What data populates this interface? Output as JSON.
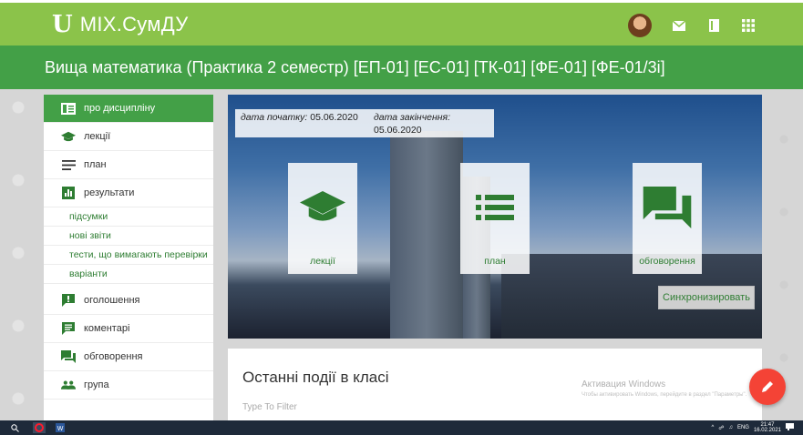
{
  "app": {
    "logo_mark": "U",
    "name": "МІХ.СумДУ"
  },
  "header_icons": [
    "avatar",
    "mail-icon",
    "book-icon",
    "apps-grid-icon"
  ],
  "course": {
    "title": "Вища математика (Практика 2 семестр) [ЕП-01] [ЕС-01] [ТК-01] [ФЕ-01] [ФЕ-01/3і]"
  },
  "sidebar": {
    "items": [
      {
        "label": "про дисципліну",
        "icon": "info-card-icon",
        "active": true
      },
      {
        "label": "лекції",
        "icon": "graduation-cap-icon"
      },
      {
        "label": "план",
        "icon": "list-icon"
      },
      {
        "label": "результати",
        "icon": "bar-chart-icon"
      }
    ],
    "sub_items": [
      "підсумки",
      "нові звіти",
      "тести, що вимагають перевірки",
      "варіанти"
    ],
    "items2": [
      {
        "label": "оголошення",
        "icon": "announcement-icon"
      },
      {
        "label": "коментарі",
        "icon": "comment-icon"
      },
      {
        "label": "обговорення",
        "icon": "forum-icon"
      },
      {
        "label": "група",
        "icon": "group-icon"
      }
    ]
  },
  "hero": {
    "start_label": "дата початку:",
    "start_date": "05.06.2020",
    "end_label": "дата закінчення:",
    "end_date": "05.06.2020",
    "tiles": [
      {
        "label": "лекції",
        "icon": "graduation-cap-icon"
      },
      {
        "label": "план",
        "icon": "list-icon"
      },
      {
        "label": "обговорення",
        "icon": "forum-icon"
      }
    ],
    "sync_label": "Синхронизировать"
  },
  "events": {
    "title": "Останні події в класі",
    "filter_placeholder": "Type To Filter",
    "win_activation": "Активация Windows",
    "win_activation_sub": "Чтобы активировать Windows, перейдите в раздел \"Параметры\"."
  },
  "taskbar": {
    "lang": "ENG",
    "time": "21:47",
    "date": "16.02.2021"
  },
  "colors": {
    "header": "#8bc34a",
    "course_bar": "#43a047",
    "accent": "#2e7d32",
    "fab": "#f44336"
  }
}
